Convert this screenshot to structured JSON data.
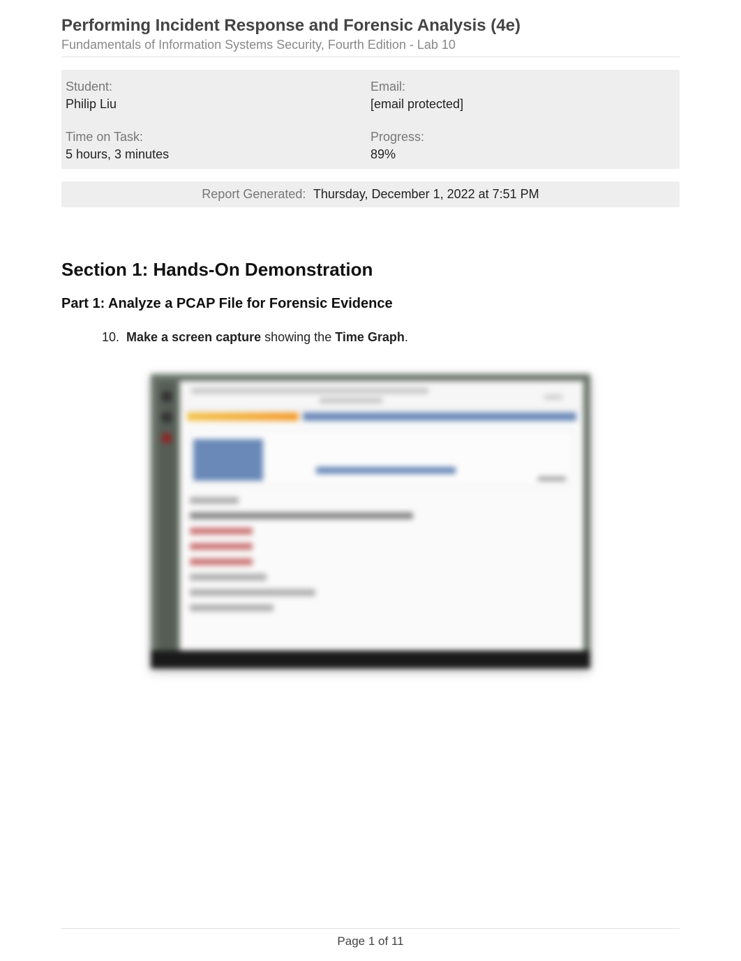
{
  "header": {
    "title": "Performing Incident Response and Forensic Analysis (4e)",
    "subtitle": "Fundamentals of Information Systems Security, Fourth Edition - Lab 10"
  },
  "info": {
    "student_label": "Student:",
    "student_value": "Philip Liu",
    "email_label": "Email:",
    "email_value": "[email protected]",
    "time_label": "Time on Task:",
    "time_value": "5 hours, 3 minutes",
    "progress_label": "Progress:",
    "progress_value": "89%",
    "generated_label": "Report Generated:",
    "generated_value": "Thursday, December 1, 2022 at 7:51 PM"
  },
  "section": {
    "title": "Section 1: Hands-On Demonstration",
    "part_title": "Part 1: Analyze a PCAP File for Forensic Evidence",
    "task_number": "10.",
    "task_bold1": "Make a screen capture",
    "task_mid": " showing the ",
    "task_bold2": "Time Graph",
    "task_end": "."
  },
  "footer": {
    "page_text": "Page 1 of 11"
  }
}
